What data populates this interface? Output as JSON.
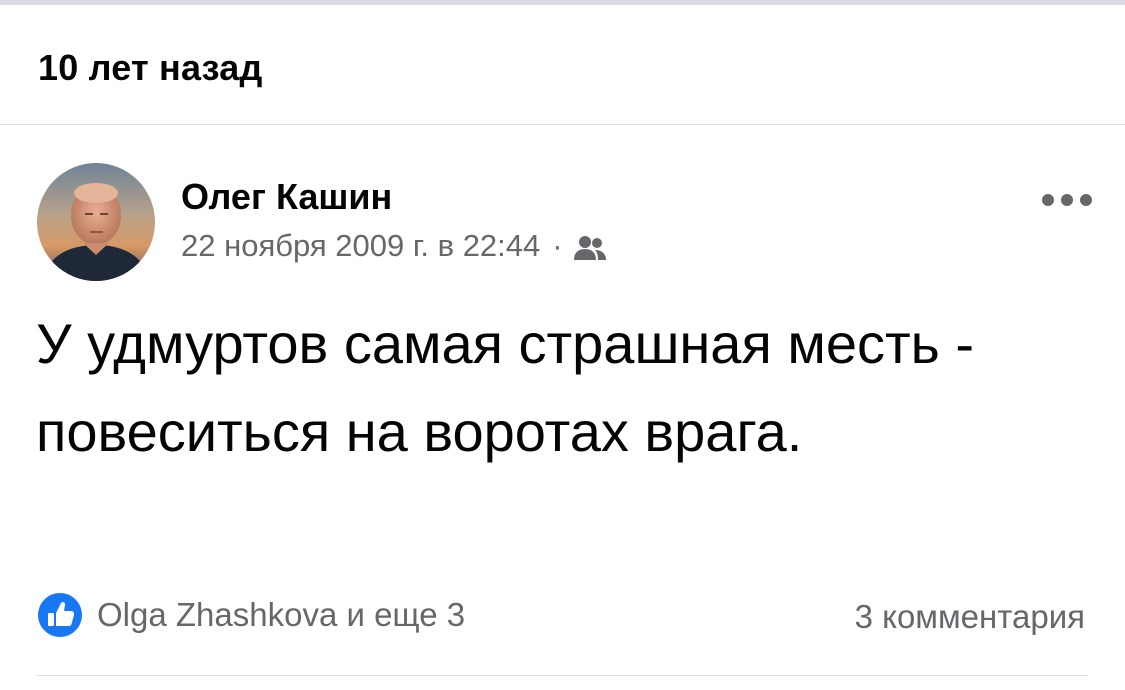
{
  "memory": {
    "title": "10 лет назад"
  },
  "post": {
    "author": "Олег Кашин",
    "timestamp": "22 ноября 2009 г. в 22:44",
    "meta_separator": "·",
    "audience_icon": "friends-icon",
    "more_icon": "more-options-icon",
    "text": "У удмуртов самая страшная месть - повеситься на воротах врага.",
    "reactions_summary": "Olga Zhashkova и еще 3",
    "reaction_icon": "like-icon",
    "comments_label": "3 комментария"
  },
  "colors": {
    "accent": "#1877f2",
    "secondary_text": "#65676b",
    "primary_text": "#050505",
    "divider": "#dfe1e5"
  }
}
